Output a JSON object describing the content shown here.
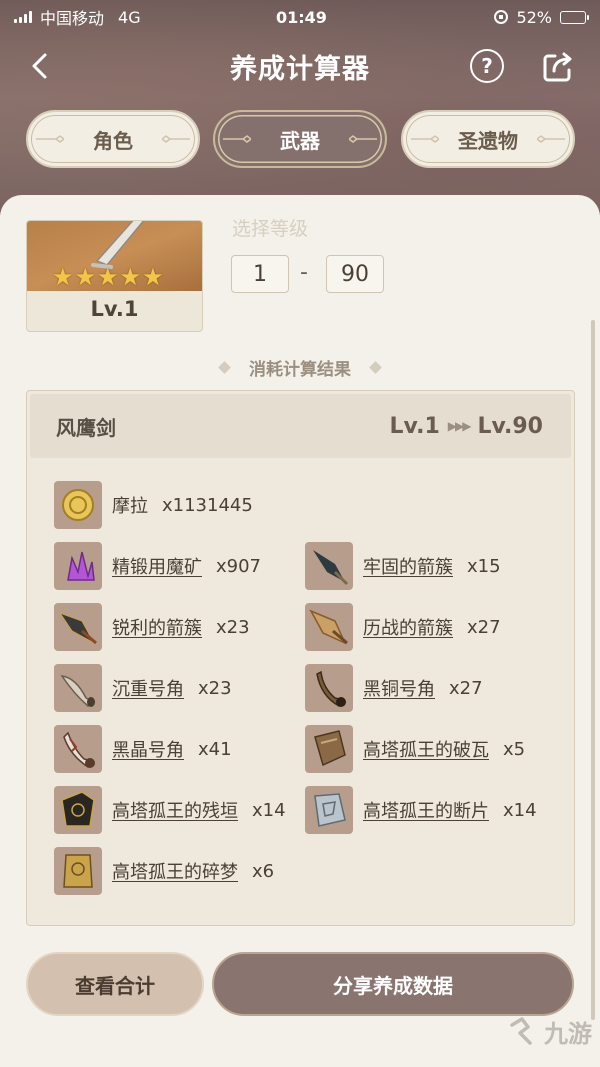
{
  "status_bar": {
    "carrier": "中国移动",
    "network": "4G",
    "time": "01:49",
    "battery_percent": "52%",
    "battery_level": 0.52
  },
  "nav": {
    "title": "养成计算器",
    "back_icon": "chevron-left-icon",
    "help_label": "?",
    "share_icon": "share-icon"
  },
  "tabs": [
    {
      "label": "角色",
      "active": false
    },
    {
      "label": "武器",
      "active": true
    },
    {
      "label": "圣遗物",
      "active": false
    }
  ],
  "weapon_card": {
    "stars": 5,
    "level": "Lv.1"
  },
  "level_select": {
    "label": "选择等级",
    "from": "1",
    "dash": "-",
    "to": "90"
  },
  "results": {
    "section_title": "消耗计算结果",
    "weapon_name": "风鹰剑",
    "lv_from": "Lv.1",
    "lv_to": "Lv.90",
    "materials": [
      {
        "name": "摩拉",
        "qty": "x1131445",
        "icon": "mora-coin-icon",
        "underlined": false
      },
      {
        "name": "精锻用魔矿",
        "qty": "x907",
        "icon": "mystic-ore-icon",
        "underlined": true
      },
      {
        "name": "牢固的箭簇",
        "qty": "x15",
        "icon": "firm-arrowhead-icon",
        "underlined": true
      },
      {
        "name": "锐利的箭簇",
        "qty": "x23",
        "icon": "sharp-arrowhead-icon",
        "underlined": true
      },
      {
        "name": "历战的箭簇",
        "qty": "x27",
        "icon": "weathered-arrowhead-icon",
        "underlined": true
      },
      {
        "name": "沉重号角",
        "qty": "x23",
        "icon": "heavy-horn-icon",
        "underlined": true
      },
      {
        "name": "黑铜号角",
        "qty": "x27",
        "icon": "black-bronze-horn-icon",
        "underlined": true
      },
      {
        "name": "黑晶号角",
        "qty": "x41",
        "icon": "black-crystal-horn-icon",
        "underlined": true
      },
      {
        "name": "高塔孤王的破瓦",
        "qty": "x5",
        "icon": "tile-fragment-icon",
        "underlined": true
      },
      {
        "name": "高塔孤王的残垣",
        "qty": "x14",
        "icon": "broken-wall-icon",
        "underlined": true
      },
      {
        "name": "高塔孤王的断片",
        "qty": "x14",
        "icon": "shattered-piece-icon",
        "underlined": true
      },
      {
        "name": "高塔孤王的碎梦",
        "qty": "x6",
        "icon": "broken-dream-icon",
        "underlined": true
      }
    ]
  },
  "buttons": {
    "total": "查看合计",
    "share": "分享养成数据"
  },
  "watermark": "九游",
  "colors": {
    "accent": "#84706c",
    "sheet_bg": "#f4f1ea",
    "panel_bg": "#efe9dd",
    "star": "#f3c64a"
  }
}
